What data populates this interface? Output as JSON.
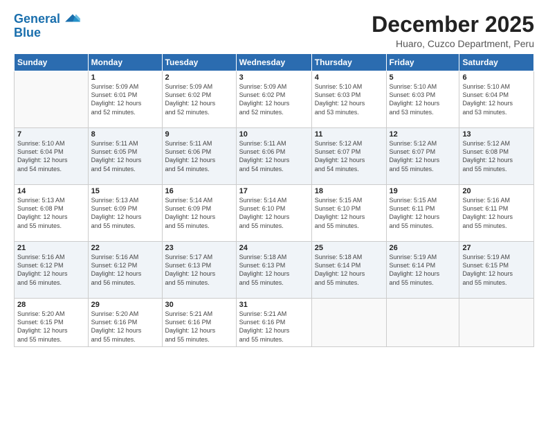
{
  "logo": {
    "line1": "General",
    "line2": "Blue"
  },
  "title": "December 2025",
  "subtitle": "Huaro, Cuzco Department, Peru",
  "days_of_week": [
    "Sunday",
    "Monday",
    "Tuesday",
    "Wednesday",
    "Thursday",
    "Friday",
    "Saturday"
  ],
  "weeks": [
    [
      {
        "day": "",
        "info": ""
      },
      {
        "day": "1",
        "info": "Sunrise: 5:09 AM\nSunset: 6:01 PM\nDaylight: 12 hours\nand 52 minutes."
      },
      {
        "day": "2",
        "info": "Sunrise: 5:09 AM\nSunset: 6:02 PM\nDaylight: 12 hours\nand 52 minutes."
      },
      {
        "day": "3",
        "info": "Sunrise: 5:09 AM\nSunset: 6:02 PM\nDaylight: 12 hours\nand 52 minutes."
      },
      {
        "day": "4",
        "info": "Sunrise: 5:10 AM\nSunset: 6:03 PM\nDaylight: 12 hours\nand 53 minutes."
      },
      {
        "day": "5",
        "info": "Sunrise: 5:10 AM\nSunset: 6:03 PM\nDaylight: 12 hours\nand 53 minutes."
      },
      {
        "day": "6",
        "info": "Sunrise: 5:10 AM\nSunset: 6:04 PM\nDaylight: 12 hours\nand 53 minutes."
      }
    ],
    [
      {
        "day": "7",
        "info": "Sunrise: 5:10 AM\nSunset: 6:04 PM\nDaylight: 12 hours\nand 54 minutes."
      },
      {
        "day": "8",
        "info": "Sunrise: 5:11 AM\nSunset: 6:05 PM\nDaylight: 12 hours\nand 54 minutes."
      },
      {
        "day": "9",
        "info": "Sunrise: 5:11 AM\nSunset: 6:06 PM\nDaylight: 12 hours\nand 54 minutes."
      },
      {
        "day": "10",
        "info": "Sunrise: 5:11 AM\nSunset: 6:06 PM\nDaylight: 12 hours\nand 54 minutes."
      },
      {
        "day": "11",
        "info": "Sunrise: 5:12 AM\nSunset: 6:07 PM\nDaylight: 12 hours\nand 54 minutes."
      },
      {
        "day": "12",
        "info": "Sunrise: 5:12 AM\nSunset: 6:07 PM\nDaylight: 12 hours\nand 55 minutes."
      },
      {
        "day": "13",
        "info": "Sunrise: 5:12 AM\nSunset: 6:08 PM\nDaylight: 12 hours\nand 55 minutes."
      }
    ],
    [
      {
        "day": "14",
        "info": "Sunrise: 5:13 AM\nSunset: 6:08 PM\nDaylight: 12 hours\nand 55 minutes."
      },
      {
        "day": "15",
        "info": "Sunrise: 5:13 AM\nSunset: 6:09 PM\nDaylight: 12 hours\nand 55 minutes."
      },
      {
        "day": "16",
        "info": "Sunrise: 5:14 AM\nSunset: 6:09 PM\nDaylight: 12 hours\nand 55 minutes."
      },
      {
        "day": "17",
        "info": "Sunrise: 5:14 AM\nSunset: 6:10 PM\nDaylight: 12 hours\nand 55 minutes."
      },
      {
        "day": "18",
        "info": "Sunrise: 5:15 AM\nSunset: 6:10 PM\nDaylight: 12 hours\nand 55 minutes."
      },
      {
        "day": "19",
        "info": "Sunrise: 5:15 AM\nSunset: 6:11 PM\nDaylight: 12 hours\nand 55 minutes."
      },
      {
        "day": "20",
        "info": "Sunrise: 5:16 AM\nSunset: 6:11 PM\nDaylight: 12 hours\nand 55 minutes."
      }
    ],
    [
      {
        "day": "21",
        "info": "Sunrise: 5:16 AM\nSunset: 6:12 PM\nDaylight: 12 hours\nand 56 minutes."
      },
      {
        "day": "22",
        "info": "Sunrise: 5:16 AM\nSunset: 6:12 PM\nDaylight: 12 hours\nand 56 minutes."
      },
      {
        "day": "23",
        "info": "Sunrise: 5:17 AM\nSunset: 6:13 PM\nDaylight: 12 hours\nand 55 minutes."
      },
      {
        "day": "24",
        "info": "Sunrise: 5:18 AM\nSunset: 6:13 PM\nDaylight: 12 hours\nand 55 minutes."
      },
      {
        "day": "25",
        "info": "Sunrise: 5:18 AM\nSunset: 6:14 PM\nDaylight: 12 hours\nand 55 minutes."
      },
      {
        "day": "26",
        "info": "Sunrise: 5:19 AM\nSunset: 6:14 PM\nDaylight: 12 hours\nand 55 minutes."
      },
      {
        "day": "27",
        "info": "Sunrise: 5:19 AM\nSunset: 6:15 PM\nDaylight: 12 hours\nand 55 minutes."
      }
    ],
    [
      {
        "day": "28",
        "info": "Sunrise: 5:20 AM\nSunset: 6:15 PM\nDaylight: 12 hours\nand 55 minutes."
      },
      {
        "day": "29",
        "info": "Sunrise: 5:20 AM\nSunset: 6:16 PM\nDaylight: 12 hours\nand 55 minutes."
      },
      {
        "day": "30",
        "info": "Sunrise: 5:21 AM\nSunset: 6:16 PM\nDaylight: 12 hours\nand 55 minutes."
      },
      {
        "day": "31",
        "info": "Sunrise: 5:21 AM\nSunset: 6:16 PM\nDaylight: 12 hours\nand 55 minutes."
      },
      {
        "day": "",
        "info": ""
      },
      {
        "day": "",
        "info": ""
      },
      {
        "day": "",
        "info": ""
      }
    ]
  ]
}
